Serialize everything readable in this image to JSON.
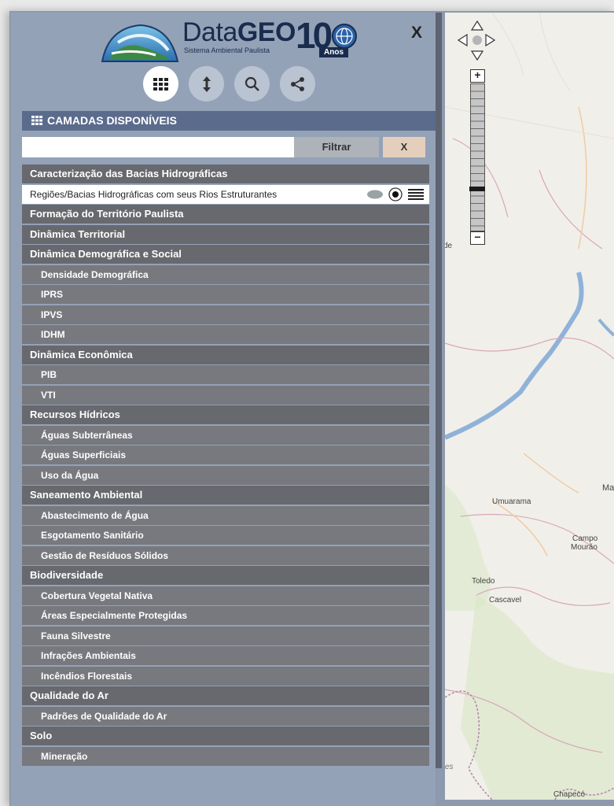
{
  "app": {
    "logo_title_light": "Data",
    "logo_title_bold": "GEO",
    "logo_subtitle": "Sistema Ambiental Paulista",
    "logo_anniversary_number": "10",
    "logo_anniversary_word": "Anos",
    "close_label": "X"
  },
  "toolbar": {
    "icons": [
      "grid-icon",
      "vertical-arrows-icon",
      "search-icon",
      "share-icon"
    ],
    "active": "grid-icon"
  },
  "panel": {
    "title": "CAMADAS DISPONÍVEIS"
  },
  "filter": {
    "value": "",
    "placeholder": "",
    "filter_button": "Filtrar",
    "clear_button": "X"
  },
  "layers": [
    {
      "type": "group",
      "label": "Caracterização das Bacias Hidrográficas"
    },
    {
      "type": "layer",
      "label": "Regiões/Bacias Hidrográficas com seus Rios Estruturantes"
    },
    {
      "type": "group",
      "label": "Formação do Território Paulista"
    },
    {
      "type": "group",
      "label": "Dinâmica Territorial"
    },
    {
      "type": "group",
      "label": "Dinâmica Demográfica e Social"
    },
    {
      "type": "sub",
      "label": "Densidade Demográfica"
    },
    {
      "type": "sub",
      "label": "IPRS"
    },
    {
      "type": "sub",
      "label": "IPVS"
    },
    {
      "type": "sub",
      "label": "IDHM"
    },
    {
      "type": "group",
      "label": "Dinâmica Econômica"
    },
    {
      "type": "sub",
      "label": "PIB"
    },
    {
      "type": "sub",
      "label": "VTI"
    },
    {
      "type": "group",
      "label": "Recursos Hídricos"
    },
    {
      "type": "sub",
      "label": "Águas Subterrâneas"
    },
    {
      "type": "sub",
      "label": "Águas Superficiais"
    },
    {
      "type": "sub",
      "label": "Uso da Água"
    },
    {
      "type": "group",
      "label": "Saneamento Ambiental"
    },
    {
      "type": "sub",
      "label": "Abastecimento de Água"
    },
    {
      "type": "sub",
      "label": "Esgotamento Sanitário"
    },
    {
      "type": "sub",
      "label": "Gestão de Resíduos Sólidos"
    },
    {
      "type": "group",
      "label": "Biodiversidade"
    },
    {
      "type": "sub",
      "label": "Cobertura Vegetal Nativa"
    },
    {
      "type": "sub",
      "label": "Áreas Especialmente Protegidas"
    },
    {
      "type": "sub",
      "label": "Fauna Silvestre"
    },
    {
      "type": "sub",
      "label": "Infrações Ambientais"
    },
    {
      "type": "sub",
      "label": "Incêndios Florestais"
    },
    {
      "type": "group",
      "label": "Qualidade do Ar"
    },
    {
      "type": "sub",
      "label": "Padrões de Qualidade do Ar"
    },
    {
      "type": "group",
      "label": "Solo"
    },
    {
      "type": "sub",
      "label": "Mineração"
    }
  ],
  "map": {
    "zoom_in": "+",
    "zoom_out": "−",
    "zoom_level_fraction": 0.72,
    "places": [
      "de",
      "Umuarama",
      "Ma",
      "Campo",
      "Mourão",
      "Toledo",
      "Cascavel",
      "es",
      "Chapecó"
    ]
  },
  "colors": {
    "sidebar": "#94a2b7",
    "header": "#5b6b8c",
    "group_row": "#67696e",
    "sub_row": "#77797e",
    "filter_button": "#aeb3b9",
    "clear_button": "#e4cfbd"
  }
}
